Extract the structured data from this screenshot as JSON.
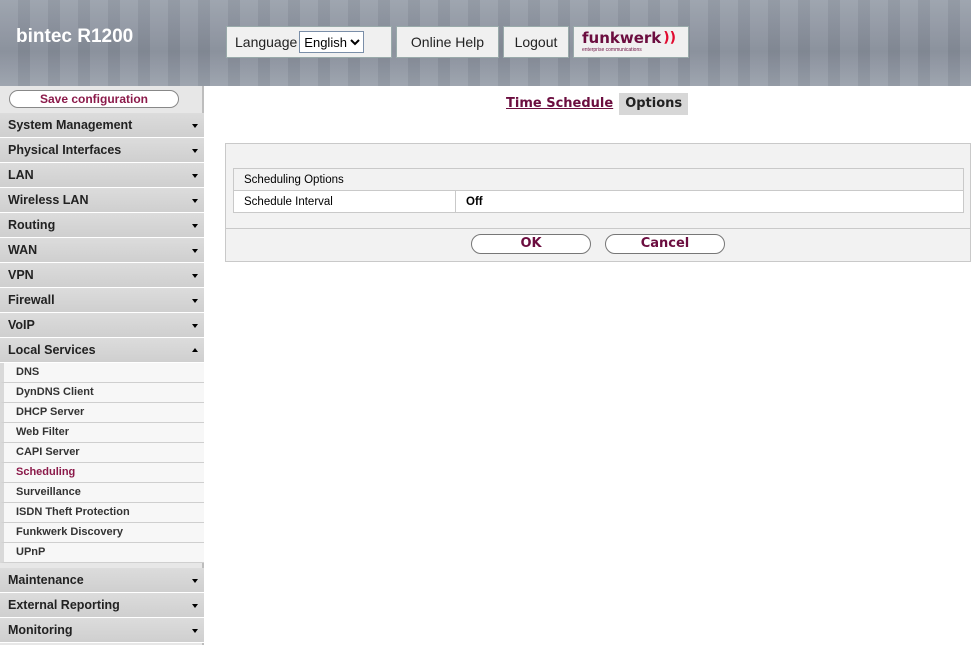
{
  "header": {
    "brand": "bintec R1200",
    "language_label": "Language",
    "language_value": "English",
    "online_help": "Online Help",
    "logout": "Logout",
    "logo_text": "funkwerk",
    "logo_subtext": "enterprise communications",
    "logo_color": "#6b0d3f"
  },
  "sidebar": {
    "save": "Save configuration",
    "items_top": [
      {
        "label": "System Management"
      },
      {
        "label": "Physical Interfaces"
      },
      {
        "label": "LAN"
      },
      {
        "label": "Wireless LAN"
      },
      {
        "label": "Routing"
      },
      {
        "label": "WAN"
      },
      {
        "label": "VPN"
      },
      {
        "label": "Firewall"
      },
      {
        "label": "VoIP"
      },
      {
        "label": "Local Services"
      }
    ],
    "subitems": [
      {
        "label": "DNS"
      },
      {
        "label": "DynDNS Client"
      },
      {
        "label": "DHCP Server"
      },
      {
        "label": "Web Filter"
      },
      {
        "label": "CAPI Server"
      },
      {
        "label": "Scheduling"
      },
      {
        "label": "Surveillance"
      },
      {
        "label": "ISDN Theft Protection"
      },
      {
        "label": "Funkwerk Discovery"
      },
      {
        "label": "UPnP"
      }
    ],
    "items_bottom": [
      {
        "label": "Maintenance"
      },
      {
        "label": "External Reporting"
      },
      {
        "label": "Monitoring"
      }
    ],
    "active_subitem": "Scheduling"
  },
  "main": {
    "tabs": [
      {
        "label": "Time Schedule"
      },
      {
        "label": "Options"
      }
    ],
    "section_title": "Scheduling Options",
    "rows": [
      {
        "label": "Schedule Interval",
        "value": "Off"
      }
    ],
    "ok": "OK",
    "cancel": "Cancel"
  },
  "colors": {
    "accent": "#6b0d3f",
    "header_bg": "#8e95a1",
    "sidebar_bg": "#d5d5d5"
  }
}
